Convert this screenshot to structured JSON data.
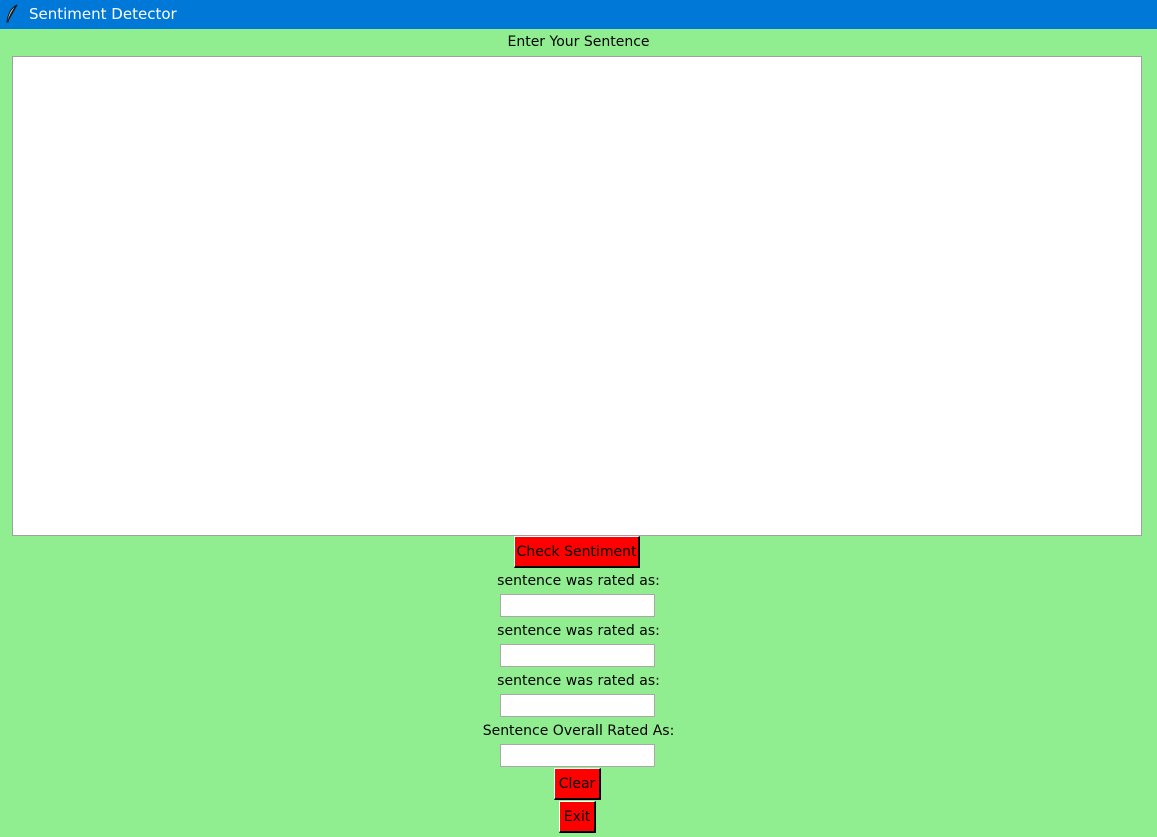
{
  "window": {
    "title": "Sentiment Detector",
    "icon": "feather-icon",
    "background_color": "#90ee90",
    "titlebar_color": "#0078d7"
  },
  "sentence": {
    "label": "Enter Your Sentence",
    "value": ""
  },
  "check_button": {
    "label": "Check Sentiment",
    "color": "#ff0000"
  },
  "results": [
    {
      "label": "sentence was rated as:",
      "value": ""
    },
    {
      "label": "sentence was rated as:",
      "value": ""
    },
    {
      "label": "sentence was rated as:",
      "value": ""
    }
  ],
  "overall": {
    "label": "Sentence Overall Rated As:",
    "value": ""
  },
  "clear_button": {
    "label": "Clear"
  },
  "exit_button": {
    "label": "Exit"
  }
}
